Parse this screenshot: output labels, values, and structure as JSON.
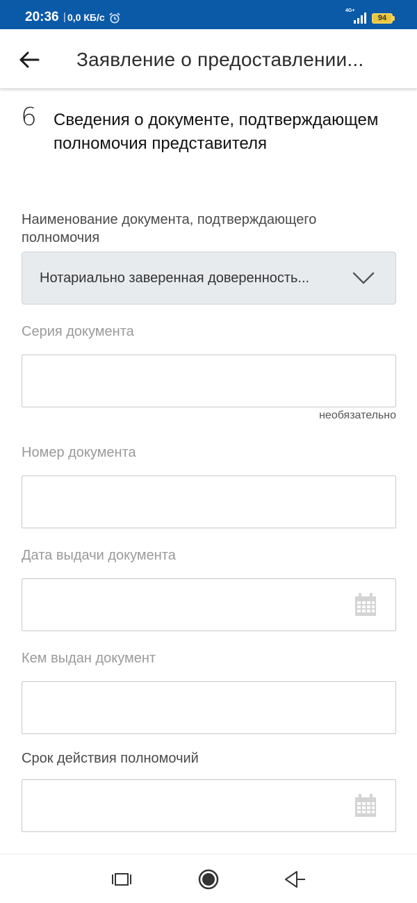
{
  "status_bar": {
    "time": "20:36",
    "separator": "|",
    "speed": "0,0 КБ/с",
    "network": "4G+",
    "battery": "94",
    "background_color": "#0b5aa8"
  },
  "app_bar": {
    "title": "Заявление о предоставлении...",
    "back_icon": "arrow-left-icon"
  },
  "section": {
    "number": "6",
    "title": "Сведения о документе, подтверждающем полномочия представителя"
  },
  "form": {
    "document_name": {
      "label": "Наименование документа, подтверждающего полномочия",
      "value": "Нотариально заверенная доверенность..."
    },
    "series": {
      "label": "Серия документа",
      "value": "",
      "note": "необязательно"
    },
    "number": {
      "label": "Номер документа",
      "value": ""
    },
    "issue_date": {
      "label": "Дата выдачи документа",
      "value": "",
      "icon": "calendar-icon"
    },
    "issued_by": {
      "label": "Кем выдан документ",
      "value": ""
    },
    "validity": {
      "label": "Срок действия полномочий",
      "value": "",
      "icon": "calendar-icon"
    }
  },
  "nav_bar": {
    "recents_icon": "recents-icon",
    "home_icon": "home-icon",
    "back_icon": "back-triangle-icon"
  }
}
